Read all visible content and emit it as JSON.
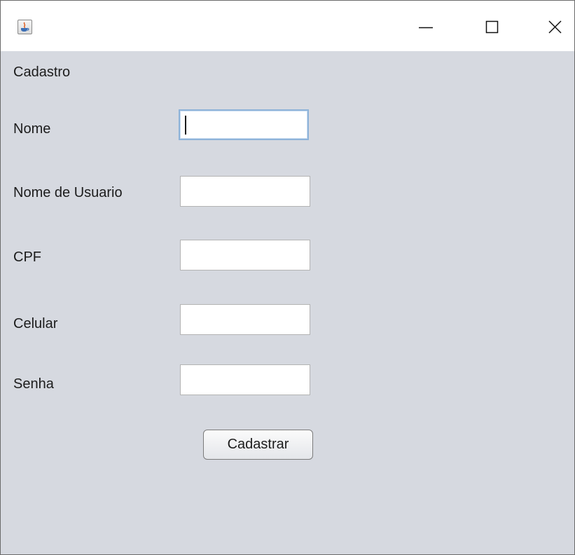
{
  "window": {
    "title": "",
    "controls": [
      "minimize-icon",
      "maximize-icon",
      "close-icon"
    ]
  },
  "form": {
    "heading": "Cadastro",
    "fields": [
      {
        "label": "Nome",
        "value": ""
      },
      {
        "label": "Nome de Usuario",
        "value": ""
      },
      {
        "label": "CPF",
        "value": ""
      },
      {
        "label": "Celular",
        "value": ""
      },
      {
        "label": "Senha",
        "value": ""
      }
    ],
    "submit_label": "Cadastrar"
  },
  "colors": {
    "background": "#d6d9e0",
    "focus_border": "#8eb3d9"
  }
}
